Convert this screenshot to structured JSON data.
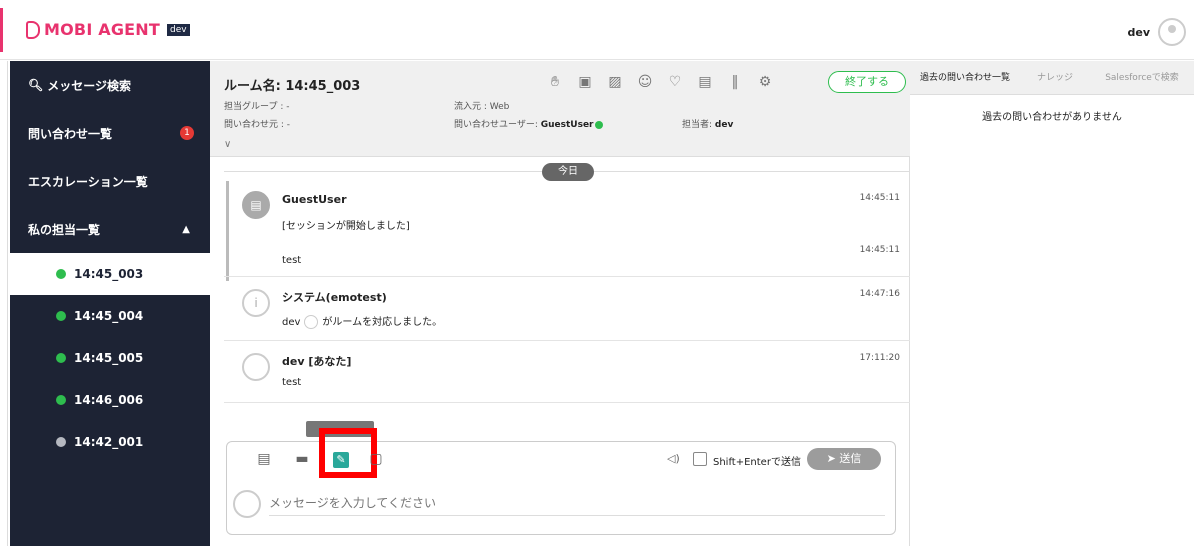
{
  "app": {
    "brand": "MOBI AGENT",
    "env_badge": "dev",
    "user_name": "dev"
  },
  "sidebar": {
    "search": "メッセージ検索",
    "inquiries": "問い合わせ一覧",
    "inquiries_badge": "1",
    "escalations": "エスカレーション一覧",
    "my_assigned": "私の担当一覧",
    "rooms": [
      {
        "label": "14:45_003",
        "status": "active"
      },
      {
        "label": "14:45_004",
        "status": "online"
      },
      {
        "label": "14:45_005",
        "status": "online"
      },
      {
        "label": "14:46_006",
        "status": "online"
      },
      {
        "label": "14:42_001",
        "status": "done"
      }
    ]
  },
  "room": {
    "title": "ルーム名: 14:45_003",
    "end_button": "終了する",
    "group_label": "担当グループ : -",
    "source_label": "問い合わせ元 : -",
    "inflow_label": "流入元 : Web",
    "user_label": "問い合わせユーザー: ",
    "user_value": "GuestUser",
    "assignee_label": "担当者: ",
    "assignee_value": "dev"
  },
  "chat": {
    "date_pill": "今日",
    "messages": [
      {
        "name": "GuestUser",
        "text": "[セッションが開始しました]",
        "time": "14:45:11"
      },
      {
        "text": "test",
        "time": "14:45:11"
      },
      {
        "name": "システム(emotest)",
        "text_user": "dev",
        "text_rest": "がルームを対応しました。",
        "time": "14:47:16"
      },
      {
        "name": "dev [あなた]",
        "text": "test",
        "time": "17:11:20"
      }
    ]
  },
  "composer": {
    "shift_enter": "Shift+Enterで送信",
    "send": "送信",
    "placeholder": "メッセージを入力してください"
  },
  "right_panel": {
    "tabs": [
      "過去の問い合わせ一覧",
      "ナレッジ",
      "Salesforceで検索"
    ],
    "empty": "過去の問い合わせがありません"
  },
  "colors": {
    "accent": "#e8336e",
    "sidebar": "#1d2334",
    "online": "#2ebd4e",
    "highlight": "#ff0000"
  }
}
